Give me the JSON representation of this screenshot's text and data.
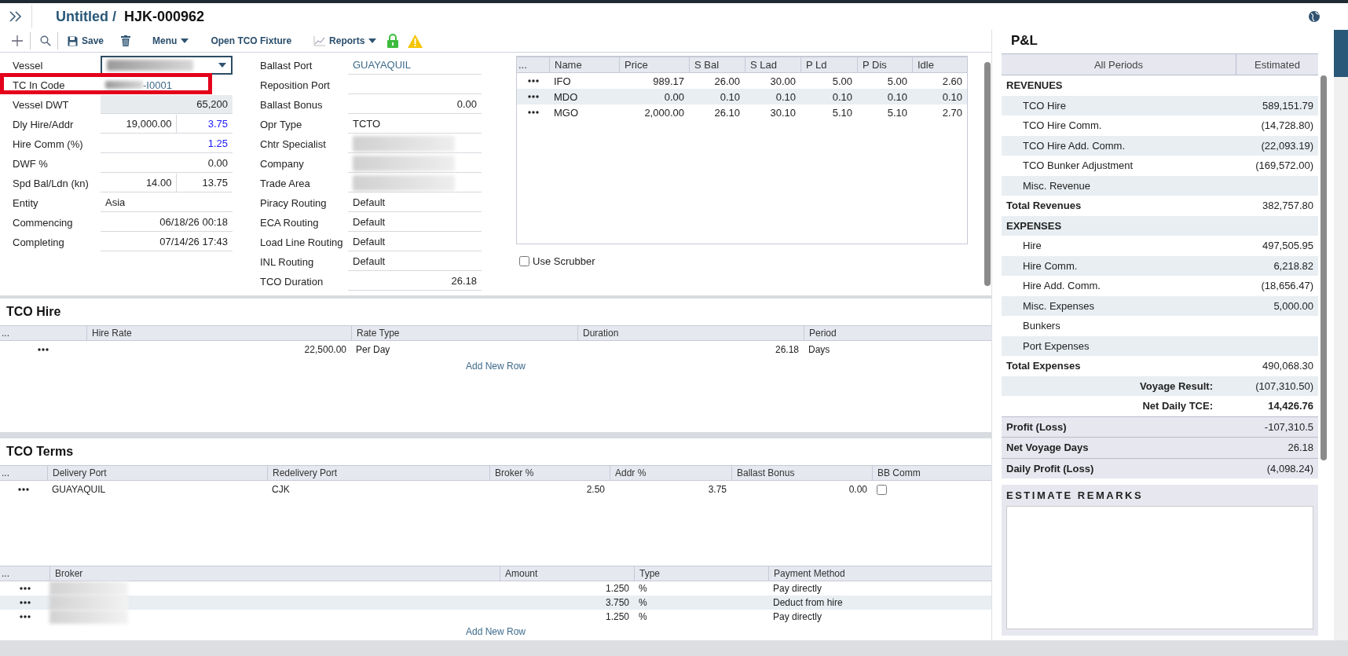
{
  "header": {
    "title": "Untitled /",
    "code": "HJK-000962"
  },
  "toolbar": [
    {
      "kind": "add"
    },
    {
      "kind": "search"
    },
    {
      "kind": "save",
      "label": "Save"
    },
    {
      "kind": "delete"
    },
    {
      "kind": "menu",
      "label": "Menu"
    },
    {
      "kind": "link",
      "label": "Open TCO Fixture"
    },
    {
      "kind": "reports",
      "label": "Reports"
    },
    {
      "kind": "lock"
    },
    {
      "kind": "warning"
    }
  ],
  "form_left": [
    {
      "label": "Vessel",
      "kind": "select"
    },
    {
      "label": "TC In Code",
      "kind": "masked",
      "value": "-I0001"
    },
    {
      "label": "Vessel DWT",
      "kind": "readonly",
      "value": "65,200"
    },
    {
      "label": "Dly Hire/Addr",
      "kind": "pair",
      "value": "19,000.00",
      "value_2": "3.75",
      "linked": true
    },
    {
      "label": "Hire Comm (%)",
      "kind": "number",
      "value": "1.25",
      "linked": true
    },
    {
      "label": "DWF %",
      "kind": "number",
      "value": "0.00",
      "linked": false
    },
    {
      "label": "Spd Bal/Ldn (kn)",
      "kind": "pair",
      "value": "14.00",
      "value_2": "13.75",
      "linked": false
    },
    {
      "label": "Entity",
      "kind": "text",
      "value": "Asia"
    },
    {
      "label": "Commencing",
      "kind": "number",
      "value": "06/18/26 00:18",
      "linked": false
    },
    {
      "label": "Completing",
      "kind": "number",
      "value": "07/14/26 17:43",
      "linked": false
    }
  ],
  "form_middle": [
    {
      "label": "Ballast Port",
      "kind": "link",
      "value": "GUAYAQUIL"
    },
    {
      "label": "Reposition Port",
      "kind": "text"
    },
    {
      "label": "Ballast Bonus",
      "kind": "number",
      "value": "0.00",
      "linked": false
    },
    {
      "label": "Opr Type",
      "kind": "text",
      "value": "TCTO"
    },
    {
      "label": "Chtr Specialist",
      "kind": "redacted"
    },
    {
      "label": "Company",
      "kind": "redacted"
    },
    {
      "label": "Trade Area",
      "kind": "redacted"
    },
    {
      "label": "Piracy Routing",
      "kind": "text",
      "value": "Default"
    },
    {
      "label": "ECA Routing",
      "kind": "text",
      "value": "Default"
    },
    {
      "label": "Load Line Routing",
      "kind": "text",
      "value": "Default"
    },
    {
      "label": "INL Routing",
      "kind": "text",
      "value": "Default"
    },
    {
      "label": "TCO Duration",
      "kind": "number",
      "value": "26.18",
      "linked": false
    }
  ],
  "bunkers": {
    "menu_header": "...",
    "columns": [
      {
        "label": "Name",
        "kind": "text"
      },
      {
        "label": "Price",
        "kind": "number"
      },
      {
        "label": "S Bal",
        "kind": "number"
      },
      {
        "label": "S Lad",
        "kind": "number"
      },
      {
        "label": "P Ld",
        "kind": "number"
      },
      {
        "label": "P Dis",
        "kind": "number"
      },
      {
        "label": "Idle",
        "kind": "number"
      }
    ],
    "rows": [
      [
        "IFO",
        "989.17",
        "26.00",
        "30.00",
        "5.00",
        "5.00",
        "2.60"
      ],
      [
        "MDO",
        "0.00",
        "0.10",
        "0.10",
        "0.10",
        "0.10",
        "0.10"
      ],
      [
        "MGO",
        "2,000.00",
        "26.10",
        "30.10",
        "5.10",
        "5.10",
        "2.70"
      ]
    ]
  },
  "use_scrubber": {
    "label": "Use Scrubber",
    "checked": false
  },
  "tco_hire": {
    "title": "TCO Hire",
    "menu_header": "...",
    "columns": [
      {
        "label": "Hire Rate",
        "kind": "number"
      },
      {
        "label": "Rate Type",
        "kind": "text"
      },
      {
        "label": "Duration",
        "kind": "number"
      },
      {
        "label": "Period",
        "kind": "text"
      }
    ],
    "rows": [
      [
        "22,500.00",
        "Per Day",
        "26.18",
        "Days"
      ]
    ],
    "add_row_link": "Add New Row"
  },
  "tco_terms": {
    "title": "TCO Terms",
    "menu_header": "...",
    "columns": [
      {
        "label": "Delivery Port",
        "kind": "text"
      },
      {
        "label": "Redelivery Port",
        "kind": "text"
      },
      {
        "label": "Broker %",
        "kind": "number"
      },
      {
        "label": "Addr %",
        "kind": "number"
      },
      {
        "label": "Ballast Bonus",
        "kind": "number"
      },
      {
        "label": "BB Comm",
        "kind": "checkbox"
      }
    ],
    "rows": [
      [
        "GUAYAQUIL",
        "CJK",
        "2.50",
        "3.75",
        "0.00",
        false
      ]
    ]
  },
  "brokers": {
    "menu_header": "...",
    "columns": [
      {
        "label": "Broker",
        "kind": "redacted"
      },
      {
        "label": "Amount",
        "kind": "number"
      },
      {
        "label": "Type",
        "kind": "text"
      },
      {
        "label": "Payment Method",
        "kind": "text"
      }
    ],
    "rows": [
      [
        "",
        "1.250",
        "%",
        "Pay directly"
      ],
      [
        "",
        "3.750",
        "%",
        "Deduct from hire"
      ],
      [
        "",
        "1.250",
        "%",
        "Pay directly"
      ]
    ],
    "add_row_link": "Add New Row"
  },
  "pnl": {
    "title": "P&L",
    "columns": [
      "All Periods",
      "Estimated"
    ],
    "rows": [
      {
        "kind": "section",
        "label": "REVENUES"
      },
      {
        "kind": "item",
        "label": "TCO Hire",
        "value": "589,151.79"
      },
      {
        "kind": "item",
        "label": "TCO Hire Comm.",
        "value": "(14,728.80)"
      },
      {
        "kind": "item",
        "label": "TCO Hire Add. Comm.",
        "value": "(22,093.19)"
      },
      {
        "kind": "item",
        "label": "TCO Bunker Adjustment",
        "value": "(169,572.00)"
      },
      {
        "kind": "item",
        "label": "Misc. Revenue"
      },
      {
        "kind": "total",
        "label": "Total Revenues",
        "value": "382,757.80"
      },
      {
        "kind": "section",
        "label": "EXPENSES"
      },
      {
        "kind": "item",
        "label": "Hire",
        "value": "497,505.95"
      },
      {
        "kind": "item",
        "label": "Hire Comm.",
        "value": "6,218.82"
      },
      {
        "kind": "item",
        "label": "Hire Add. Comm.",
        "value": "(18,656.47)"
      },
      {
        "kind": "item",
        "label": "Misc. Expenses",
        "value": "5,000.00"
      },
      {
        "kind": "item",
        "label": "Bunkers"
      },
      {
        "kind": "item",
        "label": "Port Expenses"
      },
      {
        "kind": "total",
        "label": "Total Expenses",
        "value": "490,068.30"
      },
      {
        "kind": "result",
        "label": "Voyage Result:",
        "value": "(107,310.50)"
      },
      {
        "kind": "result",
        "label": "Net Daily TCE:",
        "value": "14,426.76"
      }
    ],
    "summary": [
      {
        "label": "Profit (Loss)",
        "value": "-107,310.5"
      },
      {
        "label": "Net Voyage Days",
        "value": "26.18"
      },
      {
        "label": "Daily Profit (Loss)",
        "value": "(4,098.24)"
      }
    ]
  },
  "remarks": {
    "title": "ESTIMATE REMARKS"
  }
}
